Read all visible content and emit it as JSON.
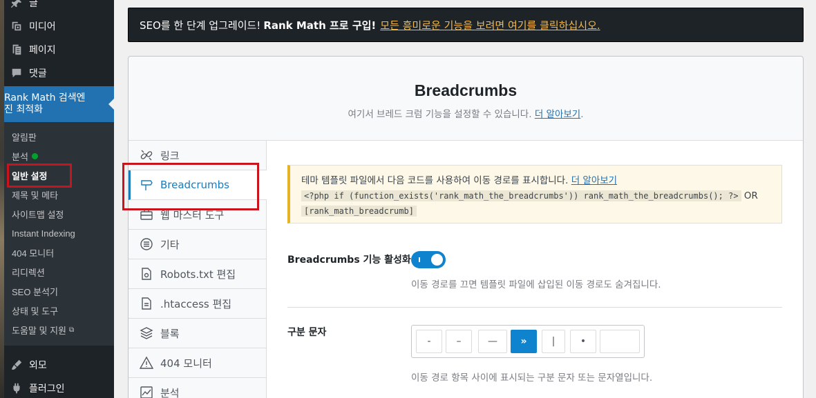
{
  "sidebar": {
    "top_items": [
      {
        "label": "글",
        "icon": "pin-icon"
      },
      {
        "label": "미디어",
        "icon": "media-icon"
      },
      {
        "label": "페이지",
        "icon": "page-icon"
      },
      {
        "label": "댓글",
        "icon": "comment-icon"
      }
    ],
    "rank_math": {
      "label": "Rank Math 검색엔진 최적화",
      "icon": "rank-math-icon"
    },
    "submenu": [
      {
        "label": "알림판"
      },
      {
        "label": "분석"
      },
      {
        "label": "일반 설정"
      },
      {
        "label": "제목 및 메타"
      },
      {
        "label": "사이트맵 설정"
      },
      {
        "label": "Instant Indexing"
      },
      {
        "label": "404 모니터"
      },
      {
        "label": "리디렉션"
      },
      {
        "label": "SEO 분석기"
      },
      {
        "label": "상태 및 도구"
      },
      {
        "label": "도움말 및 지원"
      }
    ],
    "bottom_items": [
      {
        "label": "외모",
        "icon": "brush-icon"
      },
      {
        "label": "플러그인",
        "icon": "plugin-icon"
      }
    ]
  },
  "banner": {
    "text": "SEO를 한 단계 업그레이드!",
    "bold": "Rank Math 프로 구입!",
    "link": "모든 흥미로운 기능을 보려면 여기를 클릭하십시오."
  },
  "panel": {
    "title": "Breadcrumbs",
    "description": "여기서 브레드 크럼 기능을 설정할 수 있습니다.",
    "learn_more": "더 알아보기",
    "period": "."
  },
  "tabs": [
    {
      "label": "링크",
      "icon": "link-icon"
    },
    {
      "label": "Breadcrumbs",
      "icon": "signpost-icon"
    },
    {
      "label": "웹 마스터 도구",
      "icon": "toolbox-icon"
    },
    {
      "label": "기타",
      "icon": "list-icon"
    },
    {
      "label": "Robots.txt 편집",
      "icon": "file-icon"
    },
    {
      "label": ".htaccess 편집",
      "icon": "doc-icon"
    },
    {
      "label": "블록",
      "icon": "blocks-icon"
    },
    {
      "label": "404 모니터",
      "icon": "warning-icon"
    },
    {
      "label": "분석",
      "icon": "chart-icon"
    }
  ],
  "notice": {
    "text": "테마 템플릿 파일에서 다음 코드를 사용하여 이동 경로를 표시합니다.",
    "link": "더 알아보기",
    "code1": "<?php if (function_exists('rank_math_the_breadcrumbs')) rank_math_the_breadcrumbs(); ?>",
    "or": "OR",
    "code2": "[rank_math_breadcrumb]"
  },
  "enable": {
    "label": "Breadcrumbs 기능 활성화",
    "help": "이동 경로를 끄면 템플릿 파일에 삽입된 이동 경로도 숨겨집니다.",
    "state": "on"
  },
  "separator": {
    "label": "구분 문자",
    "options": [
      "-",
      "–",
      "—",
      "»",
      "|",
      "•"
    ],
    "selected": "»",
    "custom_value": "",
    "help": "이동 경로 항목 사이에 표시되는 구분 문자 또는 문자열입니다."
  },
  "colors": {
    "accent": "#0f83cd",
    "highlight": "#c9141e",
    "banner_link": "#f7b944"
  }
}
